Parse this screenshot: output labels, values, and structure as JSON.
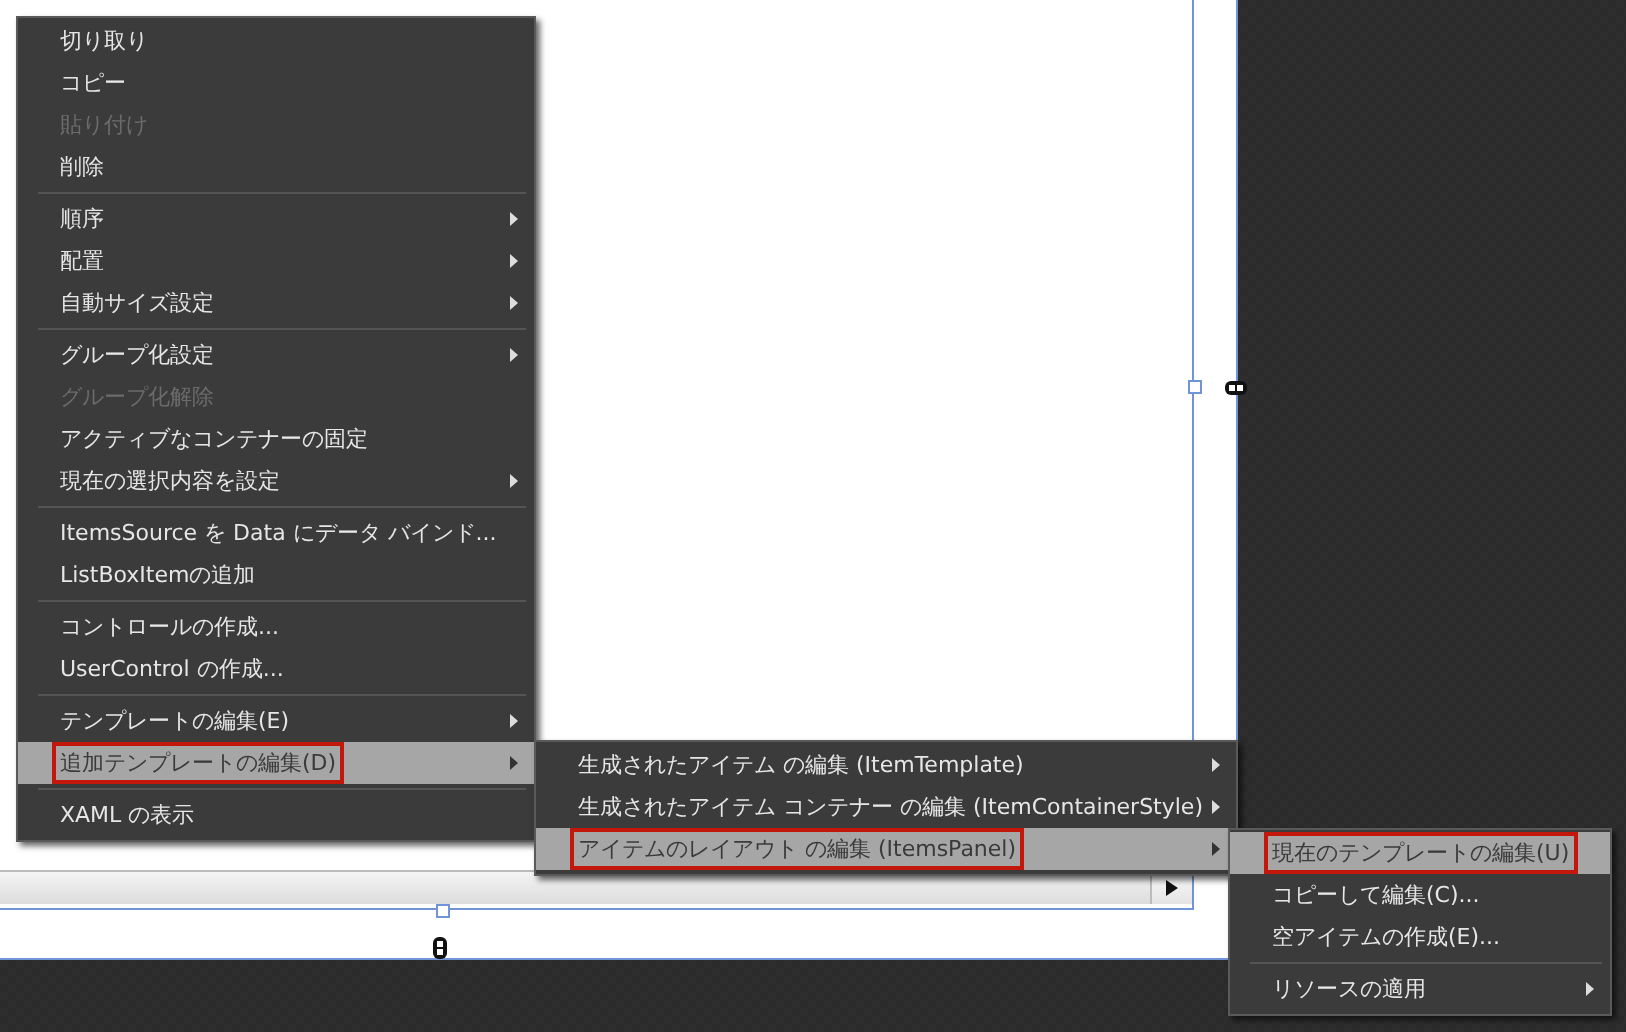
{
  "context_menu": {
    "items": [
      {
        "kind": "item",
        "label": "切り取り",
        "disabled": false,
        "submenu": false,
        "selected": false,
        "marked": false
      },
      {
        "kind": "item",
        "label": "コピー",
        "disabled": false,
        "submenu": false,
        "selected": false,
        "marked": false
      },
      {
        "kind": "item",
        "label": "貼り付け",
        "disabled": true,
        "submenu": false,
        "selected": false,
        "marked": false
      },
      {
        "kind": "item",
        "label": "削除",
        "disabled": false,
        "submenu": false,
        "selected": false,
        "marked": false
      },
      {
        "kind": "separator"
      },
      {
        "kind": "item",
        "label": "順序",
        "disabled": false,
        "submenu": true,
        "selected": false,
        "marked": false
      },
      {
        "kind": "item",
        "label": "配置",
        "disabled": false,
        "submenu": true,
        "selected": false,
        "marked": false
      },
      {
        "kind": "item",
        "label": "自動サイズ設定",
        "disabled": false,
        "submenu": true,
        "selected": false,
        "marked": false
      },
      {
        "kind": "separator"
      },
      {
        "kind": "item",
        "label": "グループ化設定",
        "disabled": false,
        "submenu": true,
        "selected": false,
        "marked": false
      },
      {
        "kind": "item",
        "label": "グループ化解除",
        "disabled": true,
        "submenu": false,
        "selected": false,
        "marked": false
      },
      {
        "kind": "item",
        "label": "アクティブなコンテナーの固定",
        "disabled": false,
        "submenu": false,
        "selected": false,
        "marked": false
      },
      {
        "kind": "item",
        "label": "現在の選択内容を設定",
        "disabled": false,
        "submenu": true,
        "selected": false,
        "marked": false
      },
      {
        "kind": "separator"
      },
      {
        "kind": "item",
        "label": "ItemsSource を Data にデータ バインド...",
        "disabled": false,
        "submenu": false,
        "selected": false,
        "marked": false
      },
      {
        "kind": "item",
        "label": "ListBoxItemの追加",
        "disabled": false,
        "submenu": false,
        "selected": false,
        "marked": false
      },
      {
        "kind": "separator"
      },
      {
        "kind": "item",
        "label": "コントロールの作成...",
        "disabled": false,
        "submenu": false,
        "selected": false,
        "marked": false
      },
      {
        "kind": "item",
        "label": "UserControl の作成...",
        "disabled": false,
        "submenu": false,
        "selected": false,
        "marked": false
      },
      {
        "kind": "separator"
      },
      {
        "kind": "item",
        "label": "テンプレートの編集(E)",
        "disabled": false,
        "submenu": true,
        "selected": false,
        "marked": false
      },
      {
        "kind": "item",
        "label": "追加テンプレートの編集(D)",
        "disabled": false,
        "submenu": true,
        "selected": true,
        "marked": true
      },
      {
        "kind": "separator"
      },
      {
        "kind": "item",
        "label": "XAML の表示",
        "disabled": false,
        "submenu": false,
        "selected": false,
        "marked": false
      }
    ]
  },
  "submenus": [
    {
      "items": [
        {
          "kind": "item",
          "label": "生成されたアイテム の編集 (ItemTemplate)",
          "disabled": false,
          "submenu": true,
          "selected": false,
          "marked": false
        },
        {
          "kind": "item",
          "label": "生成されたアイテム コンテナー の編集 (ItemContainerStyle)",
          "disabled": false,
          "submenu": true,
          "selected": false,
          "marked": false
        },
        {
          "kind": "item",
          "label": "アイテムのレイアウト の編集 (ItemsPanel)",
          "disabled": false,
          "submenu": true,
          "selected": true,
          "marked": true
        }
      ]
    },
    {
      "items": [
        {
          "kind": "item",
          "label": "現在のテンプレートの編集(U)",
          "disabled": false,
          "submenu": false,
          "selected": true,
          "marked": true
        },
        {
          "kind": "item",
          "label": "コピーして編集(C)...",
          "disabled": false,
          "submenu": false,
          "selected": false,
          "marked": false
        },
        {
          "kind": "item",
          "label": "空アイテムの作成(E)...",
          "disabled": false,
          "submenu": false,
          "selected": false,
          "marked": false
        },
        {
          "kind": "separator"
        },
        {
          "kind": "item",
          "label": "リソースの適用",
          "disabled": false,
          "submenu": true,
          "selected": false,
          "marked": false
        }
      ]
    }
  ]
}
